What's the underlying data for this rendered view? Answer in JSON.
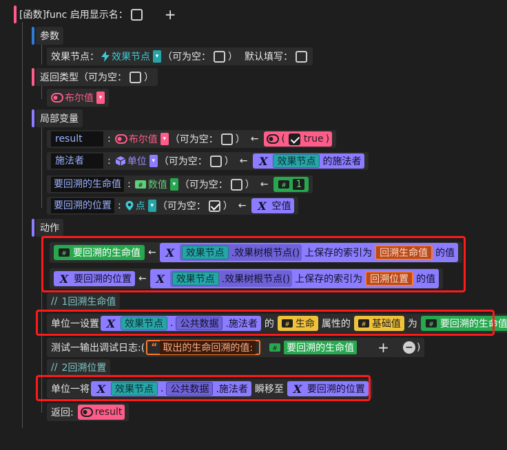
{
  "header": {
    "title": "[函数]func 启用显示名：",
    "add": "+"
  },
  "params": {
    "title": "参数",
    "row": {
      "name": "效果节点：",
      "type": "效果节点",
      "nullable": "（可为空：",
      "nullable_end": "）",
      "default": "默认填写："
    }
  },
  "ret": {
    "title": "返回类型（可为空：",
    "title_end": "）",
    "type": "布尔值"
  },
  "locals": {
    "title": "局部变量",
    "nullable": "（可为空：",
    "nullable_end": "）",
    "arrow": "←",
    "items": [
      {
        "name": "result",
        "type": "布尔值",
        "value": "true"
      },
      {
        "name": "施法者",
        "type": "单位",
        "value_node": "效果节点",
        "value_suffix": "的施法者"
      },
      {
        "name": "要回溯的生命值",
        "type": "数值",
        "value": "1"
      },
      {
        "name": "要回溯的位置",
        "type": "点",
        "value": "空值"
      }
    ]
  },
  "actions": {
    "title": "动作",
    "a1": {
      "target": "要回溯的生命值",
      "node": "效果节点",
      "method": ".效果树根节点()",
      "mid": "上保存的索引为",
      "key": "回溯生命值",
      "end": "的值"
    },
    "a2": {
      "target": "要回溯的位置",
      "node": "效果节点",
      "method": ".效果树根节点()",
      "mid": "上保存的索引为",
      "key": "回溯位置",
      "end": "的值"
    },
    "c1": "1回溯生命值",
    "a3": {
      "pre": "单位一设置",
      "node": "效果节点",
      "dot": ".",
      "field": "公共数据",
      "suffix": ".施法者",
      "of": "的",
      "attr": "生命",
      "attr_mid": "属性的",
      "base": "基础值",
      "as": "为",
      "value": "要回溯的生命值"
    },
    "a4": {
      "pre": "测试一输出调试日志:(",
      "str": "取出的生命回溯的值:",
      "value": "要回溯的生命值",
      "plus": "+",
      "minus": "−",
      "end": ")"
    },
    "c2": "2回溯位置",
    "a5": {
      "pre": "单位一将",
      "node": "效果节点",
      "dot": ".",
      "field": "公共数据",
      "suffix": ".施法者",
      "mid": "瞬移至",
      "value": "要回溯的位置"
    },
    "ret": {
      "label": "返回:",
      "value": "result"
    }
  },
  "comment_prefix": "//"
}
